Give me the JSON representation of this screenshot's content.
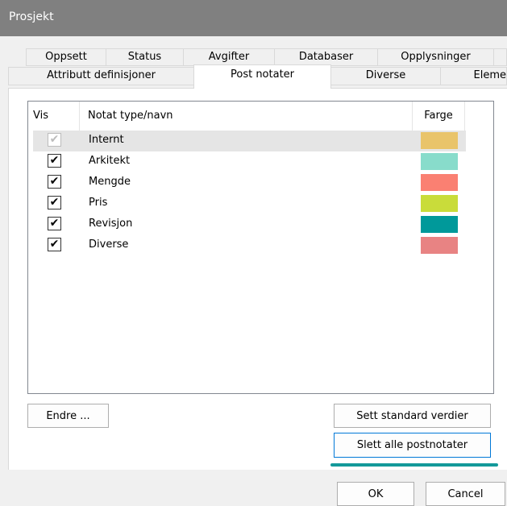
{
  "window": {
    "title": "Prosjekt"
  },
  "tabs": {
    "row1": [
      "Oppsett",
      "Status",
      "Avgifter",
      "Databaser",
      "Opplysninger"
    ],
    "row2": [
      "Attributt definisjoner",
      "Post notater",
      "Diverse",
      "Eleme"
    ],
    "active": "Post notater"
  },
  "list": {
    "columns": {
      "vis": "Vis",
      "name": "Notat type/navn",
      "farge": "Farge"
    },
    "rows": [
      {
        "checked": "✔",
        "name": "Internt",
        "color": "#e9c46a"
      },
      {
        "checked": "✔",
        "name": "Arkitekt",
        "color": "#88dccb"
      },
      {
        "checked": "✔",
        "name": "Mengde",
        "color": "#fa8072"
      },
      {
        "checked": "✔",
        "name": "Pris",
        "color": "#c9dc3a"
      },
      {
        "checked": "✔",
        "name": "Revisjon",
        "color": "#00999a"
      },
      {
        "checked": "✔",
        "name": "Diverse",
        "color": "#e88383"
      }
    ]
  },
  "buttons": {
    "endre": "Endre ...",
    "standard": "Sett standard verdier",
    "slett": "Slett alle postnotater",
    "ok": "OK",
    "cancel": "Cancel"
  },
  "colors": {
    "titlebar": "#808080",
    "accent": "#13999a"
  }
}
